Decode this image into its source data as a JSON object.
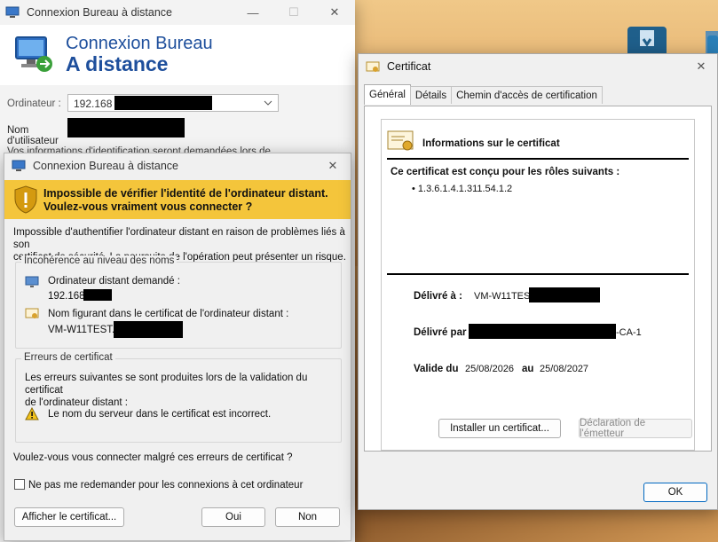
{
  "rdp": {
    "title": "Connexion Bureau à distance",
    "header_line1": "Connexion Bureau",
    "header_line2": "A distance",
    "computer_label": "Ordinateur :",
    "computer_value": "192.168",
    "username_label": "Nom d'utilisateur :",
    "info_line": "Vos informations d'identification seront demandées lors de la"
  },
  "warn": {
    "title": "Connexion Bureau à distance",
    "banner_line1": "Impossible de vérifier l'identité de l'ordinateur distant.",
    "banner_line2": "Voulez-vous vraiment vous connecter ?",
    "intro_line1": "Impossible d'authentifier l'ordinateur distant en raison de problèmes liés à son",
    "intro_line2": "certificat de sécurité. La poursuite de l'opération peut présenter un risque.",
    "group1_title": "Incohérence au niveau des noms",
    "requested_label": "Ordinateur distant demandé :",
    "requested_value": "192.168",
    "certname_label": "Nom figurant dans le certificat de l'ordinateur distant :",
    "certname_value": "VM-W11TEST.",
    "group2_title": "Erreurs de certificat",
    "errors_line1": "Les erreurs suivantes se sont produites lors de la validation du certificat",
    "errors_line2": "de l'ordinateur distant :",
    "error_item": "Le nom du serveur dans le certificat est incorrect.",
    "question": "Voulez-vous vous connecter malgré ces erreurs de certificat ?",
    "checkbox_label": "Ne pas me redemander pour les connexions à cet ordinateur",
    "view_cert_button": "Afficher le certificat...",
    "yes_button": "Oui",
    "no_button": "Non"
  },
  "cert": {
    "title": "Certificat",
    "tabs": [
      "Général",
      "Détails",
      "Chemin d'accès de certification"
    ],
    "info_title": "Informations sur le certificat",
    "purpose_heading": "Ce certificat est conçu pour les rôles suivants :",
    "purpose_item": "• 1.3.6.1.4.1.311.54.1.2",
    "issued_to_label": "Délivré à :",
    "issued_to_value": "VM-W11TEST",
    "issued_by_label": "Délivré par",
    "issued_by_suffix": "-CA-1",
    "valid_label": "Valide du",
    "valid_from": "25/08/2026",
    "valid_to_label": "au",
    "valid_to": "25/08/2027",
    "install_button": "Installer un certificat...",
    "issuer_statement_button": "Déclaration de l'émetteur",
    "ok_button": "OK"
  }
}
